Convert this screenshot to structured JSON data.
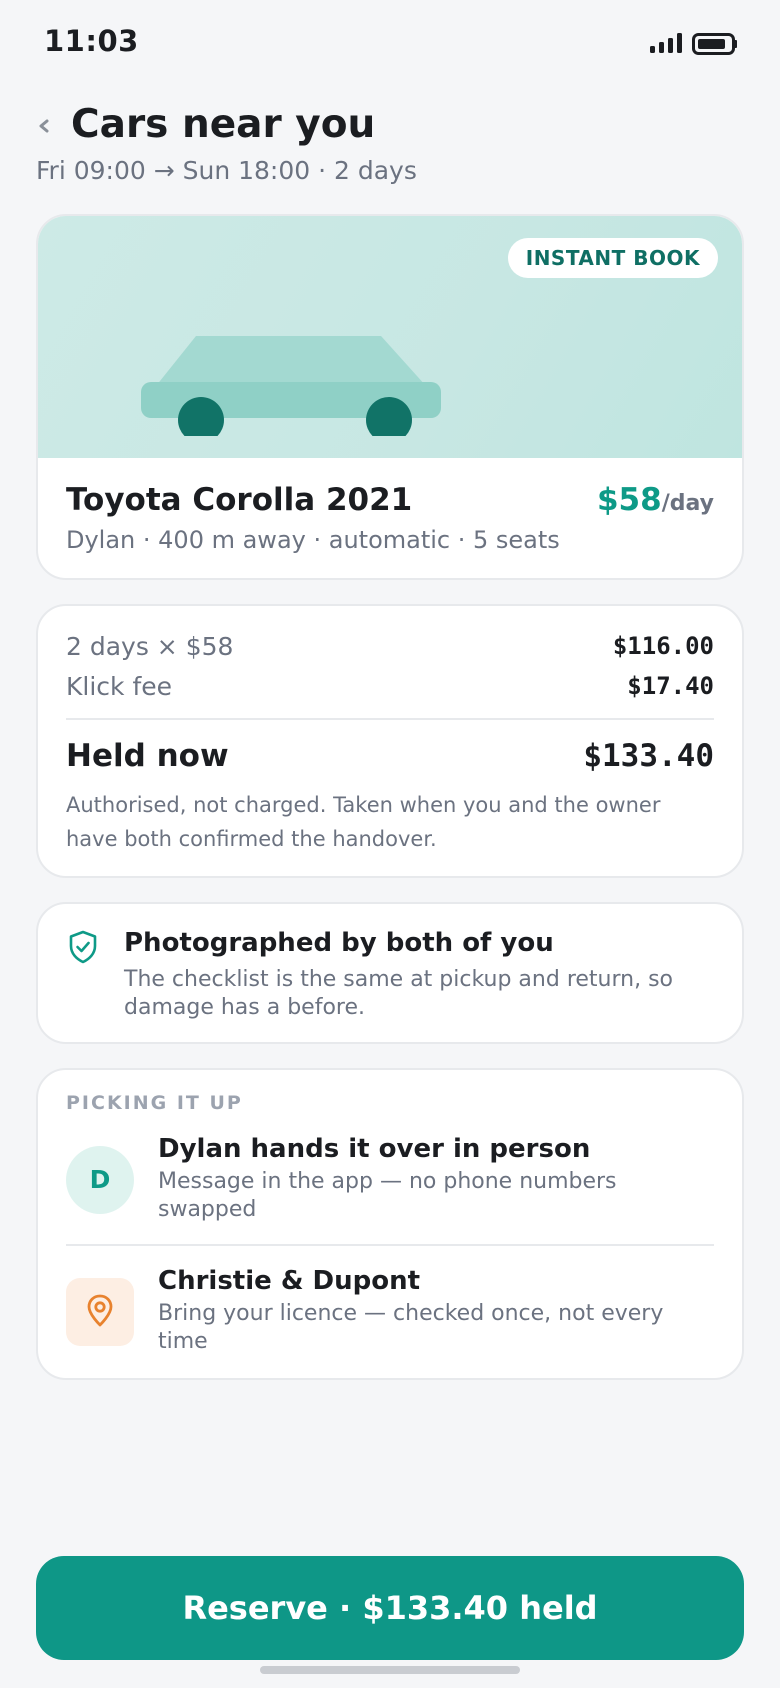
{
  "status_bar": {
    "time": "11:03",
    "icons": [
      "cellular-signal-icon",
      "battery-icon"
    ]
  },
  "header": {
    "back_icon": "chevron-left-icon",
    "title": "Cars near you",
    "subtitle": "Fri 09:00 → Sun 18:00 · 2 days"
  },
  "car": {
    "badge": "INSTANT BOOK",
    "illustration": "car-icon",
    "name": "Toyota Corolla 2021",
    "price": "$58",
    "price_unit": "/day",
    "meta": "Dylan · 400 m away · automatic · 5 seats"
  },
  "pricing": {
    "rows": [
      {
        "label": "2 days × $58",
        "value": "$116.00"
      },
      {
        "label": "Klick fee",
        "value": "$17.40"
      }
    ],
    "held_label": "Held now",
    "held_value": "$133.40",
    "note": "Authorised, not charged. Taken when you and the owner have both confirmed the handover."
  },
  "photo_check": {
    "icon": "shield-check-icon",
    "title": "Photographed by both of you",
    "text": "The checklist is the same at pickup and return, so damage has a before."
  },
  "pickup": {
    "section_label": "PICKING IT UP",
    "handover": {
      "avatar_initial": "D",
      "title": "Dylan hands it over in person",
      "text": "Message in the app — no phone numbers swapped"
    },
    "location": {
      "icon": "map-pin-icon",
      "title": "Christie & Dupont",
      "text": "Bring your licence — checked once, not every time"
    }
  },
  "cta": {
    "label": "Reserve · $133.40 held"
  },
  "colors": {
    "accent": "#0e9787",
    "accent_text": "#0e9a87",
    "badge_text": "#0f6f64",
    "hero_bg": "#c7e7e3",
    "location_accent": "#e8822e",
    "muted_text": "#6b7280"
  }
}
